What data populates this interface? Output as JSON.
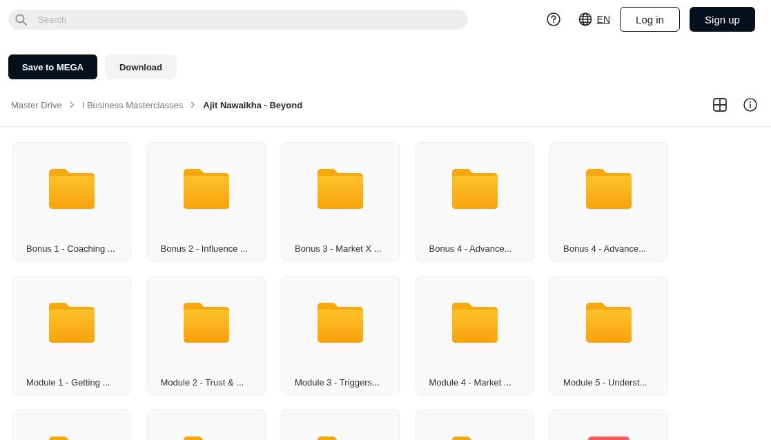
{
  "search": {
    "placeholder": "Search"
  },
  "header": {
    "language": "EN",
    "buttons": [
      {
        "label": "Log in",
        "kind": "outline"
      },
      {
        "label": "Sign up",
        "kind": "primary"
      }
    ]
  },
  "actions": [
    {
      "label": "Save to MEGA",
      "kind": "primary"
    },
    {
      "label": "Download",
      "kind": "secondary"
    }
  ],
  "breadcrumb": [
    {
      "label": "Master Drive",
      "current": false
    },
    {
      "label": "I Business Masterclasses",
      "current": false
    },
    {
      "label": "Ajit Nawalkha - Beyond",
      "current": true
    }
  ],
  "items": [
    {
      "kind": "folder",
      "name": "Bonus 1 - Coaching ..."
    },
    {
      "kind": "folder",
      "name": "Bonus 2 - Influence ..."
    },
    {
      "kind": "folder",
      "name": "Bonus 3 - Market X ..."
    },
    {
      "kind": "folder",
      "name": "Bonus 4 - Advance..."
    },
    {
      "kind": "folder",
      "name": "Bonus 4 - Advance..."
    },
    {
      "kind": "folder",
      "name": "Module 1 - Getting ..."
    },
    {
      "kind": "folder",
      "name": "Module 2 - Trust & ..."
    },
    {
      "kind": "folder",
      "name": "Module 3 - Triggers..."
    },
    {
      "kind": "folder",
      "name": "Module 4 - Market ..."
    },
    {
      "kind": "folder",
      "name": "Module 5 - Underst..."
    },
    {
      "kind": "folder"
    },
    {
      "kind": "folder"
    },
    {
      "kind": "folder"
    },
    {
      "kind": "folder"
    },
    {
      "kind": "file"
    }
  ]
}
